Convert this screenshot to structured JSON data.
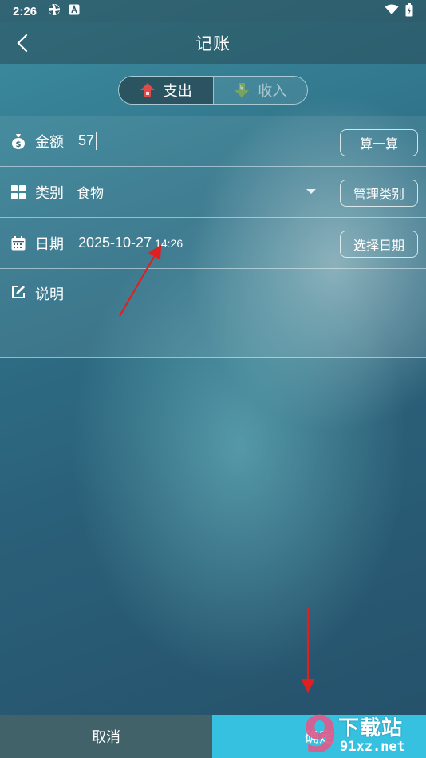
{
  "status_bar": {
    "time": "2:26"
  },
  "app_bar": {
    "title": "记账"
  },
  "tabs": [
    {
      "label": "支出",
      "icon": "arrow-up-icon",
      "color": "#e24a4a",
      "selected": true
    },
    {
      "label": "收入",
      "icon": "yen-down-icon",
      "color": "#8fb24a",
      "selected": false
    }
  ],
  "form": {
    "amount": {
      "label": "金额",
      "value": "57",
      "button": "算一算"
    },
    "category": {
      "label": "类别",
      "value": "食物",
      "button": "管理类别"
    },
    "date": {
      "label": "日期",
      "date_value": "2025-10-27",
      "time_value": "14:26",
      "button": "选择日期"
    },
    "note": {
      "label": "说明",
      "value": ""
    }
  },
  "bottom": {
    "cancel": "取消",
    "confirm": "确定"
  },
  "watermark": {
    "title": "下载站",
    "url": "91xz.net",
    "digit": "9"
  },
  "colors": {
    "confirm": "#37c1e0",
    "annotation_arrow": "#e02020"
  }
}
